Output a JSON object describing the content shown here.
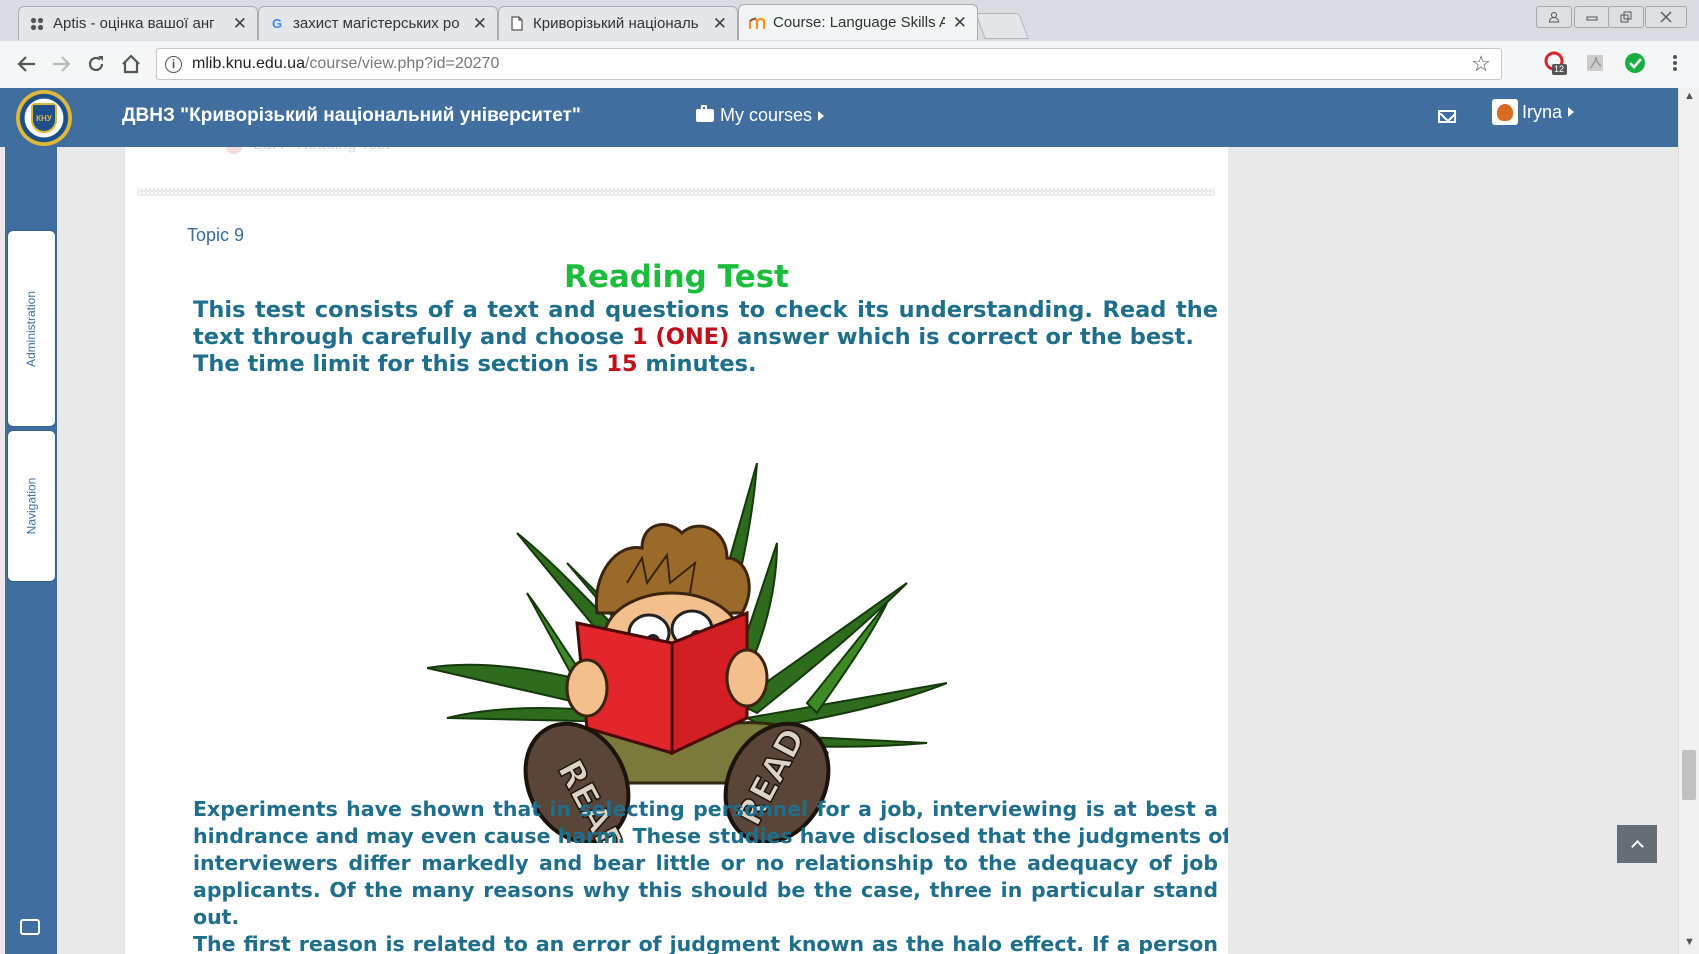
{
  "browser": {
    "tabs": [
      {
        "title": "Aptis - оцінка вашої анг",
        "icon": "apps-icon",
        "active": false
      },
      {
        "title": "захист магістерських ро",
        "icon": "google-icon",
        "active": false
      },
      {
        "title": "Криворізький національ",
        "icon": "document-icon",
        "active": false
      },
      {
        "title": "Course: Language Skills A",
        "icon": "moodle-icon",
        "active": true
      }
    ],
    "close_glyph": "✕",
    "url_host": "mlib.knu.edu.ua",
    "url_path": "/course/view.php?id=20270",
    "extension_badge": "12"
  },
  "header": {
    "site_title": "ДВНЗ \"Криворізький національний університет\"",
    "my_courses": "My courses",
    "user_name": "Iryna",
    "logo_text": "КНУ"
  },
  "sidebar": {
    "administration": "Administration",
    "navigation": "Navigation"
  },
  "content": {
    "ghost_link": "LSA - Reading Test",
    "topic": "Topic 9",
    "title": "Reading Test",
    "intro": {
      "l1": "This test consists of a text and questions to check its understanding. Read the",
      "l2_a": "text through carefully and choose ",
      "l2_red": "1 (ONE)",
      "l2_b": " answer which is correct or the best.",
      "l3_a": "The time limit for this section is ",
      "l3_red": "15",
      "l3_b": " minutes."
    },
    "image_text_left": "READ",
    "image_text_right": "READ",
    "paragraph": {
      "l1": "Experiments have shown that in selecting personnel for a job, interviewing is at best a",
      "l2": "hindrance and may even cause harm. These studies have disclosed that the judgments of",
      "l3": "interviewers differ markedly and bear little or no relationship to the adequacy of job",
      "l4": "applicants. Of the many reasons why this should be the case, three in particular stand",
      "l5": "out.",
      "l6": "The first reason is related to an error of judgment known as the halo effect. If a person"
    }
  },
  "colors": {
    "header_blue": "#3f6e9f",
    "title_green": "#1cbc3c",
    "text_teal": "#1e6e8c",
    "highlight_red": "#c0101a"
  }
}
